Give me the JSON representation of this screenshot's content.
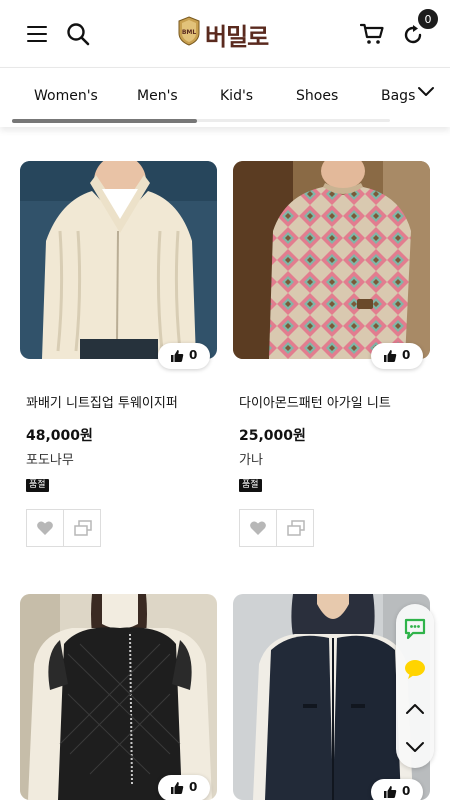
{
  "header": {
    "logo_text": "버밀로",
    "logo_badge_text": "BML",
    "refresh_count": "0",
    "colors": {
      "logo": "#5a2a1e",
      "badge_bg": "#1c1c1c"
    }
  },
  "categories": {
    "items": [
      "Women's",
      "Men's",
      "Kid's",
      "Shoes",
      "Bags"
    ]
  },
  "products": [
    {
      "name": "꽈배기 니트집업 투웨이지퍼",
      "price": "48,000원",
      "brand": "포도나무",
      "status": "품절",
      "likes": "0"
    },
    {
      "name": "다이아몬드패턴 아가일 니트",
      "price": "25,000원",
      "brand": "가나",
      "status": "품절",
      "likes": "0"
    },
    {
      "likes": "0"
    },
    {
      "likes": "0"
    }
  ],
  "float_panel": {
    "icons": [
      "chat-icon",
      "kakao-talk-icon",
      "scroll-up-icon",
      "scroll-down-icon"
    ],
    "colors": {
      "chat": "#2fb34a",
      "kakao": "#ffd400"
    }
  }
}
